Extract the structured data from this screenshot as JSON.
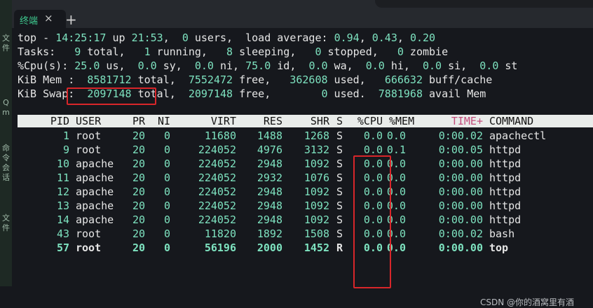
{
  "tab": {
    "title": "终端",
    "close": "×",
    "new": "+"
  },
  "sidebar_glyphs": [
    "文",
    "件",
    "Q",
    "m",
    "命",
    "令",
    "会",
    "话",
    "文",
    "件"
  ],
  "top_line": {
    "cmd": "top",
    "sep": " - ",
    "time": "14:25:17",
    "up_label": " up ",
    "uptime": "21:53",
    "comma1": ",  ",
    "users": "0",
    "users_label": " users,  load average: ",
    "load1": "0.94",
    "c1": ", ",
    "load5": "0.43",
    "c2": ", ",
    "load15": "0.20"
  },
  "tasks_line": {
    "label": "Tasks:   ",
    "total": "9",
    "t_total": " total,   ",
    "running": "1",
    "t_running": " running,   ",
    "sleeping": "8",
    "t_sleeping": " sleeping,   ",
    "stopped": "0",
    "t_stopped": " stopped,   ",
    "zombie": "0",
    "t_zombie": " zombie"
  },
  "cpu_line": {
    "label": "%Cpu(s): ",
    "us": "25.0",
    "t_us": " us,  ",
    "sy": "0.0",
    "t_sy": " sy,  ",
    "ni": "0.0",
    "t_ni": " ni, ",
    "id": "75.0",
    "t_id": " id,  ",
    "wa": "0.0",
    "t_wa": " wa,  ",
    "hi": "0.0",
    "t_hi": " hi,  ",
    "si": "0.0",
    "t_si": " si,  ",
    "st": "0.0",
    "t_st": " st"
  },
  "mem_line": {
    "label": "KiB Mem :  ",
    "total": "8581712",
    "t_total": " total,  ",
    "free": "7552472",
    "t_free": " free,   ",
    "used": "362608",
    "t_used": " used,   ",
    "cache": "666632",
    "t_cache": " buff/cache"
  },
  "swap_line": {
    "label": "KiB Swap:  ",
    "total": "2097148",
    "t_total": " total,  ",
    "free": "2097148",
    "t_free": " free,        ",
    "used": "0",
    "t_used": " used.  ",
    "avail": "7881968",
    "t_avail": " avail Mem"
  },
  "columns": [
    "PID",
    "USER",
    "PR",
    "NI",
    "VIRT",
    "RES",
    "SHR",
    "S",
    "%CPU",
    "%MEM",
    "TIME+",
    "COMMAND"
  ],
  "processes": [
    {
      "pid": "1",
      "user": "root",
      "pr": "20",
      "ni": "0",
      "virt": "11680",
      "res": "1488",
      "shr": "1268",
      "s": "S",
      "cpu": "0.0",
      "mem": "0.0",
      "time": "0:00.02",
      "cmd": "apachectl"
    },
    {
      "pid": "9",
      "user": "root",
      "pr": "20",
      "ni": "0",
      "virt": "224052",
      "res": "4976",
      "shr": "3132",
      "s": "S",
      "cpu": "0.0",
      "mem": "0.1",
      "time": "0:00.05",
      "cmd": "httpd"
    },
    {
      "pid": "10",
      "user": "apache",
      "pr": "20",
      "ni": "0",
      "virt": "224052",
      "res": "2948",
      "shr": "1092",
      "s": "S",
      "cpu": "0.0",
      "mem": "0.0",
      "time": "0:00.00",
      "cmd": "httpd"
    },
    {
      "pid": "11",
      "user": "apache",
      "pr": "20",
      "ni": "0",
      "virt": "224052",
      "res": "2932",
      "shr": "1076",
      "s": "S",
      "cpu": "0.0",
      "mem": "0.0",
      "time": "0:00.00",
      "cmd": "httpd"
    },
    {
      "pid": "12",
      "user": "apache",
      "pr": "20",
      "ni": "0",
      "virt": "224052",
      "res": "2948",
      "shr": "1092",
      "s": "S",
      "cpu": "0.0",
      "mem": "0.0",
      "time": "0:00.00",
      "cmd": "httpd"
    },
    {
      "pid": "13",
      "user": "apache",
      "pr": "20",
      "ni": "0",
      "virt": "224052",
      "res": "2948",
      "shr": "1092",
      "s": "S",
      "cpu": "0.0",
      "mem": "0.0",
      "time": "0:00.00",
      "cmd": "httpd"
    },
    {
      "pid": "14",
      "user": "apache",
      "pr": "20",
      "ni": "0",
      "virt": "224052",
      "res": "2948",
      "shr": "1092",
      "s": "S",
      "cpu": "0.0",
      "mem": "0.0",
      "time": "0:00.00",
      "cmd": "httpd"
    },
    {
      "pid": "43",
      "user": "root",
      "pr": "20",
      "ni": "0",
      "virt": "11820",
      "res": "1892",
      "shr": "1508",
      "s": "S",
      "cpu": "0.0",
      "mem": "0.0",
      "time": "0:00.02",
      "cmd": "bash"
    },
    {
      "pid": "57",
      "user": "root",
      "pr": "20",
      "ni": "0",
      "virt": "56196",
      "res": "2000",
      "shr": "1452",
      "s": "R",
      "cpu": "0.0",
      "mem": "0.0",
      "time": "0:00.00",
      "cmd": "top"
    }
  ],
  "watermark": "CSDN @你的酒窝里有酒",
  "colors": {
    "value": "#7ee3c0",
    "text": "#e6e6e6",
    "header_bg": "#e9ecea",
    "time_header": "#c34d7c",
    "highlight_box": "#d8262a"
  }
}
